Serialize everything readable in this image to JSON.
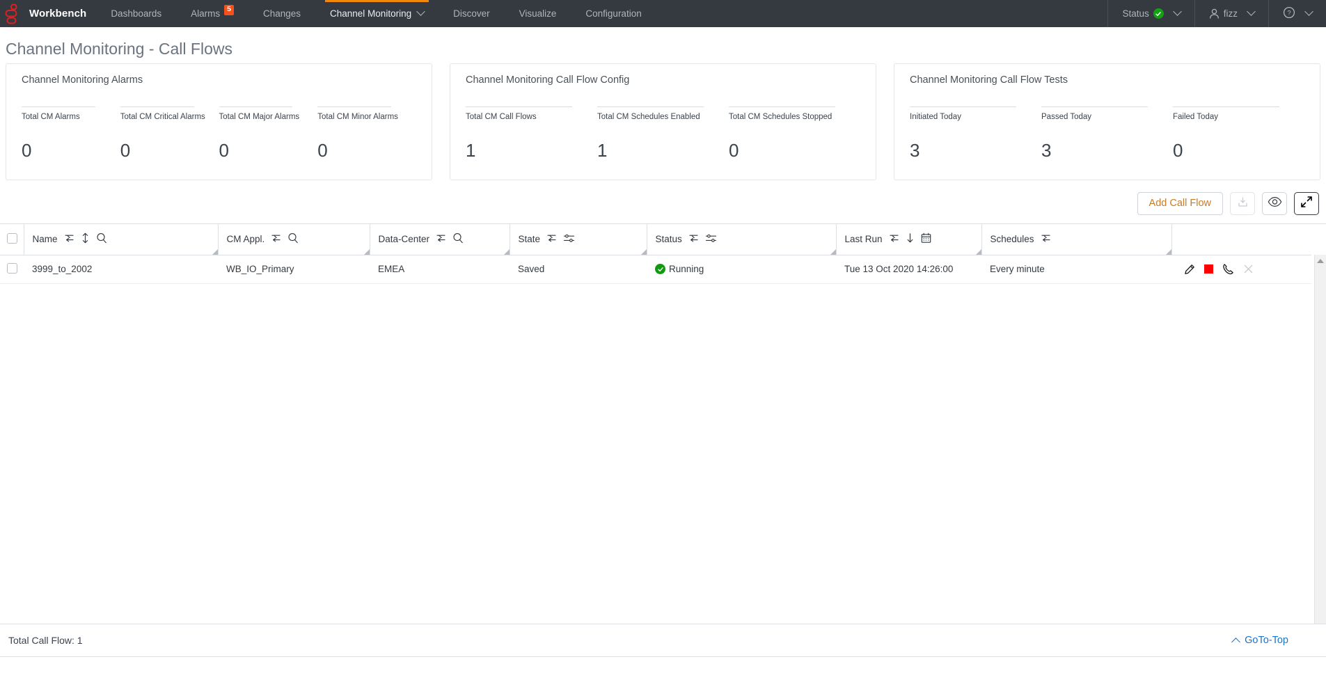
{
  "navbar": {
    "logo_icon": "chalkline-logo-icon",
    "brand": "Workbench",
    "items": [
      {
        "label": "Dashboards",
        "active": false,
        "badge": null,
        "caret": false
      },
      {
        "label": "Alarms",
        "active": false,
        "badge": "5",
        "caret": false
      },
      {
        "label": "Changes",
        "active": false,
        "badge": null,
        "caret": false
      },
      {
        "label": "Channel Monitoring",
        "active": true,
        "badge": null,
        "caret": true
      },
      {
        "label": "Discover",
        "active": false,
        "badge": null,
        "caret": false
      },
      {
        "label": "Visualize",
        "active": false,
        "badge": null,
        "caret": false
      },
      {
        "label": "Configuration",
        "active": false,
        "badge": null,
        "caret": false
      }
    ],
    "right": {
      "status_label": "Status",
      "status_icon": "status-ok-check-icon",
      "status_color": "#12a112",
      "user_label": "fizz",
      "user_icon": "user-avatar-icon",
      "help_icon": "help-question-icon"
    }
  },
  "page": {
    "title": "Channel Monitoring - Call Flows"
  },
  "cards": [
    {
      "title": "Channel Monitoring Alarms",
      "metrics": [
        {
          "label": "Total CM Alarms",
          "value": "0"
        },
        {
          "label": "Total CM Critical Alarms",
          "value": "0"
        },
        {
          "label": "Total CM Major Alarms",
          "value": "0"
        },
        {
          "label": "Total CM Minor Alarms",
          "value": "0"
        }
      ]
    },
    {
      "title": "Channel Monitoring Call Flow Config",
      "metrics": [
        {
          "label": "Total CM Call Flows",
          "value": "1"
        },
        {
          "label": "Total CM Schedules Enabled",
          "value": "1"
        },
        {
          "label": "Total CM Schedules Stopped",
          "value": "0"
        }
      ]
    },
    {
      "title": "Channel Monitoring Call Flow Tests",
      "metrics": [
        {
          "label": "Initiated Today",
          "value": "3"
        },
        {
          "label": "Passed Today",
          "value": "3"
        },
        {
          "label": "Failed Today",
          "value": "0"
        }
      ]
    }
  ],
  "toolbar": {
    "add_label": "Add Call Flow",
    "download_icon": "download-tray-icon",
    "preview_icon": "eye-icon",
    "fullscreen_icon": "expand-arrows-icon"
  },
  "table": {
    "columns": [
      {
        "label": "Name",
        "icons": [
          "filter-icon",
          "sort-updown-icon",
          "search-icon"
        ]
      },
      {
        "label": "CM Appl.",
        "icons": [
          "filter-icon",
          "search-icon"
        ]
      },
      {
        "label": "Data-Center",
        "icons": [
          "filter-icon",
          "search-icon"
        ]
      },
      {
        "label": "State",
        "icons": [
          "filter-icon",
          "settings-sliders-icon"
        ]
      },
      {
        "label": "Status",
        "icons": [
          "filter-icon",
          "settings-sliders-icon"
        ]
      },
      {
        "label": "Last Run",
        "icons": [
          "filter-icon",
          "sort-desc-icon",
          "calendar-icon"
        ]
      },
      {
        "label": "Schedules",
        "icons": [
          "filter-icon"
        ]
      },
      {
        "label": "",
        "icons": []
      }
    ],
    "rows": [
      {
        "selected": false,
        "name": "3999_to_2002",
        "cm_appl": "WB_IO_Primary",
        "data_center": "EMEA",
        "state": "Saved",
        "status": "Running",
        "status_icon": "status-running-check-icon",
        "status_color": "#119a11",
        "last_run": "Tue 13 Oct 2020 14:26:00",
        "schedules": "Every minute",
        "actions": [
          "edit-pencil-icon",
          "stop-square-icon",
          "call-phone-icon",
          "delete-x-icon"
        ]
      }
    ]
  },
  "footer": {
    "total_label": "Total Call Flow: 1",
    "goto_top_label": "GoTo-Top",
    "goto_top_icon": "chevron-up-icon"
  }
}
